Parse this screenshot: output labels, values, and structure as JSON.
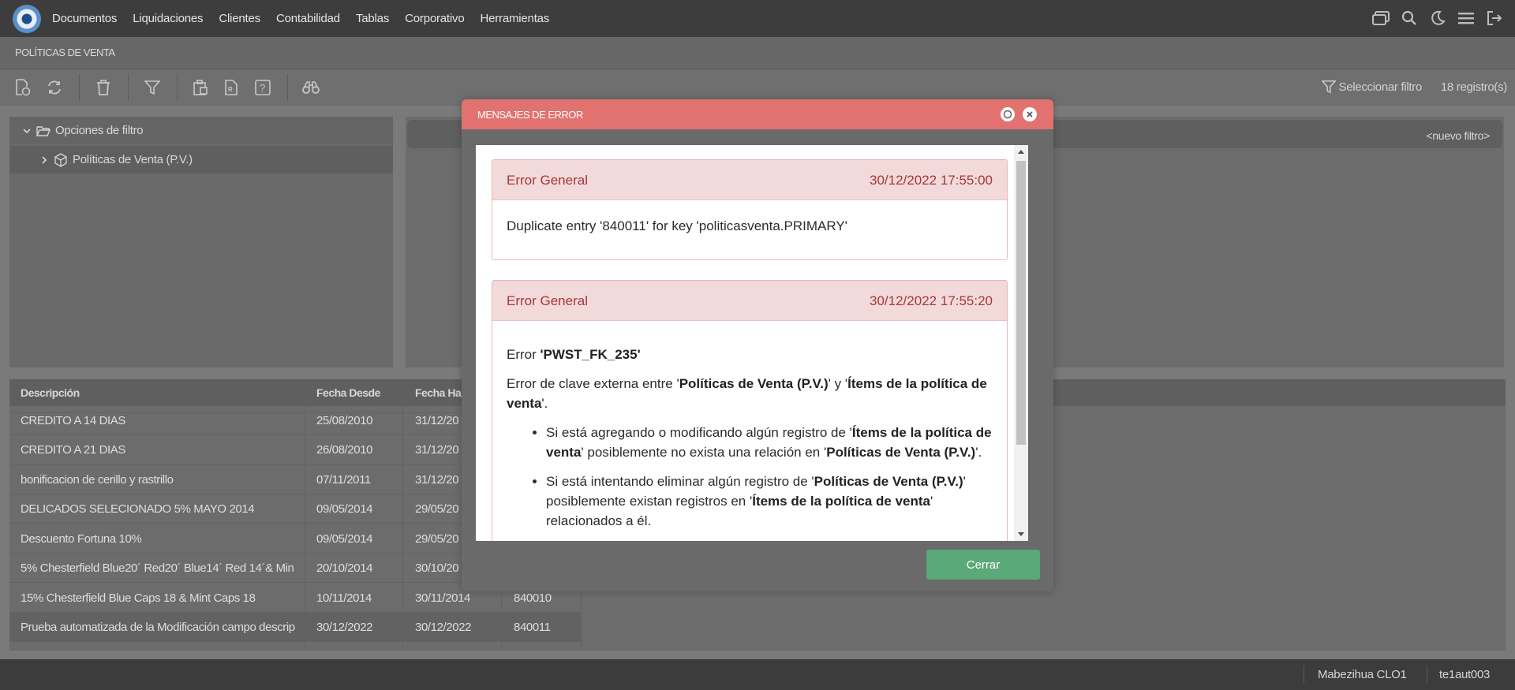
{
  "nav": {
    "menu": [
      "Documentos",
      "Liquidaciones",
      "Clientes",
      "Contabilidad",
      "Tablas",
      "Corporativo",
      "Herramientas"
    ]
  },
  "page": {
    "title": "POLÍTICAS DE VENTA"
  },
  "toolbar": {
    "filter_select": "Seleccionar filtro",
    "records": "18 registro(s)"
  },
  "filter_tree": {
    "root": "Opciones de filtro",
    "child": "Políticas de Venta (P.V.)"
  },
  "right_panel": {
    "new_filter": "<nuevo filtro>"
  },
  "table": {
    "headers": [
      "Descripción",
      "Fecha Desde",
      "Fecha Ha"
    ],
    "rows": [
      {
        "desc": "CREDITO A 14 DIAS",
        "desde": "25/08/2010",
        "hasta": "31/12/20",
        "code": ""
      },
      {
        "desc": "CREDITO A 21 DIAS",
        "desde": "26/08/2010",
        "hasta": "31/12/20",
        "code": ""
      },
      {
        "desc": "bonificacion de cerillo y rastrillo",
        "desde": "07/11/2011",
        "hasta": "31/12/20",
        "code": ""
      },
      {
        "desc": "DELICADOS SELECIONADO 5% MAYO 2014",
        "desde": "09/05/2014",
        "hasta": "29/05/20",
        "code": ""
      },
      {
        "desc": "Descuento Fortuna 10%",
        "desde": "09/05/2014",
        "hasta": "29/05/20",
        "code": ""
      },
      {
        "desc": "5% Chesterfield Blue20´ Red20´ Blue14´ Red 14´& Min",
        "desde": "20/10/2014",
        "hasta": "30/10/20",
        "code": ""
      },
      {
        "desc": "15% Chesterfield Blue Caps 18 & Mint Caps 18",
        "desde": "10/11/2014",
        "hasta": "30/11/2014",
        "code": "840010"
      },
      {
        "desc": "Prueba automatizada de la Modificación campo descrip",
        "desde": "30/12/2022",
        "hasta": "30/12/2022",
        "code": "840011"
      }
    ]
  },
  "status": {
    "user_name": "Mabezihua CLO1",
    "user_id": "te1aut003"
  },
  "modal": {
    "title": "MENSAJES DE ERROR",
    "errors": [
      {
        "type": "Error General",
        "date": "30/12/2022 17:55:00",
        "message": "Duplicate entry '840011' for key 'politicasventa.PRIMARY'"
      },
      {
        "type": "Error General",
        "date": "30/12/2022 17:55:20",
        "code_prefix": "Error ",
        "code": "'PWST_FK_235'",
        "desc_prefix": "Error de clave externa entre '",
        "entity1": "Políticas de Venta (P.V.)",
        "desc_mid": "' y '",
        "entity2": "Ítems de la política de venta",
        "desc_suffix": "'.",
        "bullet1_prefix": "Si está agregando o modificando algún registro de '",
        "bullet1_entity": "Ítems de la política de venta",
        "bullet1_mid": "' posiblemente no exista una relación en '",
        "bullet1_entity2": "Políticas de Venta (P.V.)",
        "bullet1_suffix": "'.",
        "bullet2_prefix": "Si está intentando eliminar algún registro de '",
        "bullet2_entity": "Políticas de Venta (P.V.)",
        "bullet2_mid": "' posiblemente existan registros en '",
        "bullet2_entity2": "Ítems de la política de venta",
        "bullet2_suffix": "' relacionados a él."
      }
    ],
    "close_label": "Cerrar"
  }
}
